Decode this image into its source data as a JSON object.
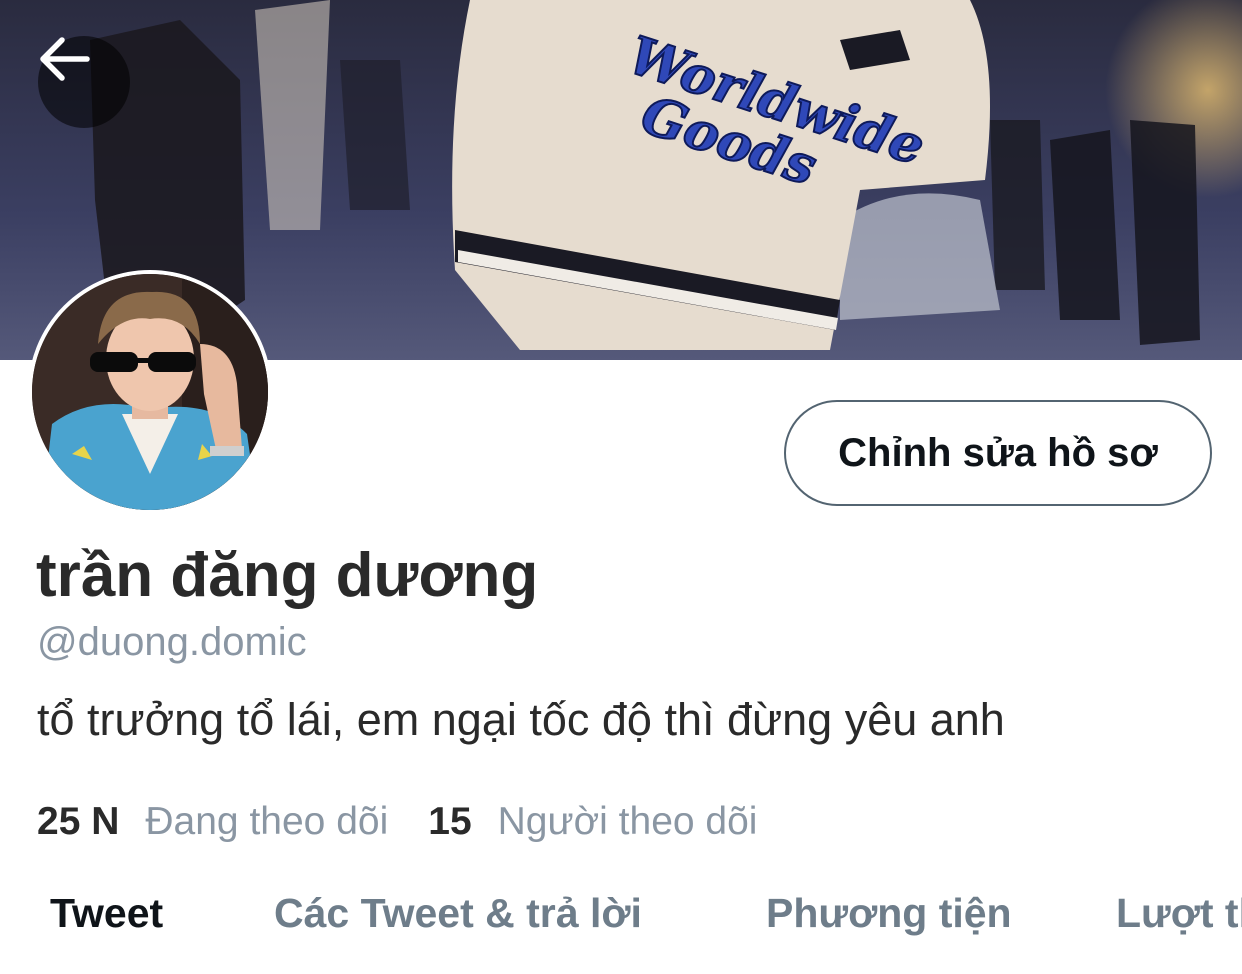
{
  "header": {
    "back_icon": "arrow-left-icon",
    "banner_text": [
      "Worldwide",
      "Goods"
    ]
  },
  "profile": {
    "display_name": "trần đăng dương",
    "handle": "@duong.domic",
    "bio": "tổ trưởng tổ lái, em ngại tốc độ thì đừng yêu anh",
    "edit_button_label": "Chỉnh sửa hồ sơ",
    "stats": {
      "following_count": "25 N",
      "following_label": "Đang theo dõi",
      "followers_count": "15",
      "followers_label": "Người theo dõi"
    }
  },
  "tabs": [
    {
      "label": "Tweet",
      "active": true
    },
    {
      "label": "Các Tweet & trả lời",
      "active": false
    },
    {
      "label": "Phương tiện",
      "active": false
    },
    {
      "label": "Lượt thích",
      "active": false
    }
  ],
  "colors": {
    "text_primary": "#0f1419",
    "text_secondary": "#8a96a3",
    "button_border": "#536471"
  }
}
